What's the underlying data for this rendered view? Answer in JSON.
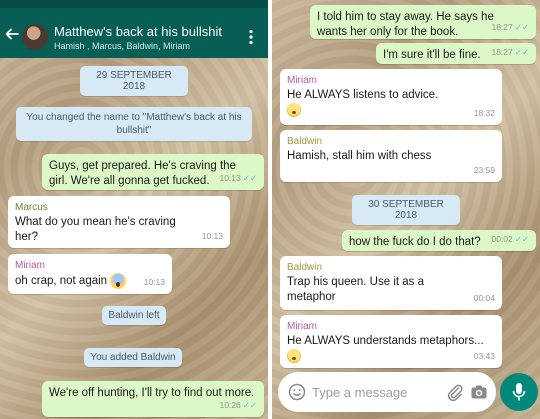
{
  "header": {
    "title": "Matthew's back at his bullshit",
    "members": "Hamish , Marcus, Baldwin, Miriam",
    "icons": {
      "back": "arrow-left-icon",
      "menu": "more-vertical-icon"
    }
  },
  "left": {
    "date_chip": "29 SEPTEMBER 2018",
    "system_rename": "You changed the name to \"Matthew's back at his bullshit\"",
    "msg1": {
      "text": "Guys, get prepared. He's craving the girl. We're all gonna get fucked.",
      "time": "10:13",
      "ticks": "✓✓"
    },
    "msg2": {
      "sender": "Marcus",
      "text": "What do you mean he's craving her?",
      "time": "10:13"
    },
    "msg3": {
      "sender": "Miriam",
      "text": "oh crap, not again",
      "emoji": "face-screaming-in-fear",
      "time": "10:13"
    },
    "system_left": "Baldwin left",
    "system_added": "You added Baldwin",
    "msg4": {
      "text": "We're off hunting, I'll try to find out more.",
      "time": "10:26",
      "ticks": "✓✓"
    }
  },
  "right": {
    "msg1": {
      "text": "I told him to stay away. He says he wants her only for the book.",
      "time": "18:27",
      "ticks": "✓✓"
    },
    "msg2": {
      "text": "I'm sure it'll be fine.",
      "time": "18:27",
      "ticks": "✓✓"
    },
    "msg3": {
      "sender": "Miriam",
      "text": "He ALWAYS listens to advice.",
      "emoji": "flushed-face",
      "time": "18:32"
    },
    "msg4": {
      "sender": "Baldwin",
      "text": "Hamish, stall him with chess",
      "time": "23:59"
    },
    "date_chip": "30 SEPTEMBER 2018",
    "msg5": {
      "text": "how the fuck do I do that?",
      "time": "00:02",
      "ticks": "✓✓"
    },
    "msg6": {
      "sender": "Baldwin",
      "text": "Trap his queen. Use it as a metaphor",
      "time": "00:04"
    },
    "msg7": {
      "sender": "Miriam",
      "text": "He ALWAYS understands metaphors...",
      "emoji": "flushed-face",
      "time": "03:43"
    }
  },
  "composer": {
    "placeholder": "Type a message",
    "icons": {
      "emoji": "smiley-icon",
      "attach": "paperclip-icon",
      "camera": "camera-icon",
      "mic": "microphone-icon"
    }
  },
  "colors": {
    "header": "#075e54",
    "outgoing": "#dcf8c6",
    "incoming": "#ffffff",
    "chip": "#d6e9f5",
    "mic": "#00897b",
    "ticks": "#4fc3f7"
  }
}
